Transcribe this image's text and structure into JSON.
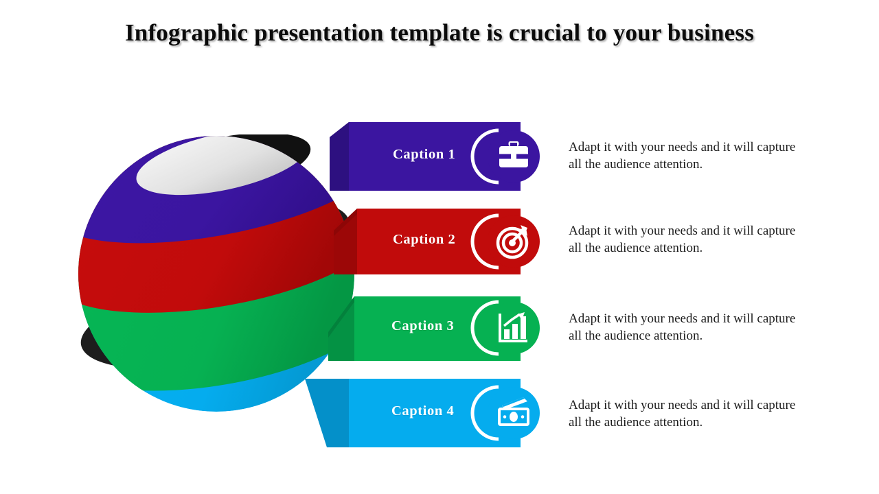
{
  "slide": {
    "title": "Infographic presentation template is crucial to your business",
    "background_color": "#ffffff",
    "title_color": "#0b0b0b"
  },
  "sphere": {
    "name": "layered-3d-sphere",
    "cap_color_light": "#eeeeee",
    "cap_color_dark": "#c9c9c9",
    "bands": [
      {
        "name": "band-purple",
        "color": "#3b15a0",
        "shade": "#32118b"
      },
      {
        "name": "band-red",
        "color": "#c10b0b",
        "shade": "#a60909"
      },
      {
        "name": "band-green",
        "color": "#06b152",
        "shade": "#059a47"
      },
      {
        "name": "band-cyan",
        "color": "#05acee",
        "shade": "#049ad4"
      }
    ]
  },
  "items": [
    {
      "caption": "Caption 1",
      "description": "Adapt it with your needs and it will capture all the audience attention.",
      "color": "#3b15a0",
      "tail_color": "#2d1080",
      "icon": "briefcase-icon"
    },
    {
      "caption": "Caption 2",
      "description": "Adapt it with your needs and it will capture all the audience attention.",
      "color": "#c10b0b",
      "tail_color": "#9c0707",
      "icon": "target-arrow-icon"
    },
    {
      "caption": "Caption 3",
      "description": "Adapt it with your needs and it will capture all the audience attention.",
      "color": "#06b152",
      "tail_color": "#049244",
      "icon": "bar-chart-growth-icon"
    },
    {
      "caption": "Caption 4",
      "description": "Adapt it with your needs and it will capture all the audience attention.",
      "color": "#05acee",
      "tail_color": "#0490c9",
      "icon": "money-banknote-icon"
    }
  ]
}
